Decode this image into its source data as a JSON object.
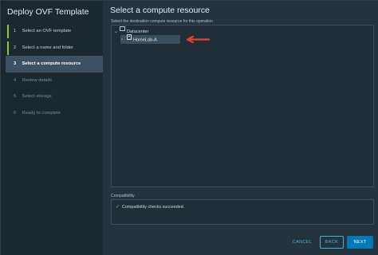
{
  "wizard": {
    "title": "Deploy OVF Template",
    "steps": [
      {
        "num": "1",
        "label": "Select an OVF template"
      },
      {
        "num": "2",
        "label": "Select a name and folder"
      },
      {
        "num": "3",
        "label": "Select a compute resource"
      },
      {
        "num": "4",
        "label": "Review details"
      },
      {
        "num": "5",
        "label": "Select storage"
      },
      {
        "num": "6",
        "label": "Ready to complete"
      }
    ]
  },
  "main": {
    "title": "Select a compute resource",
    "subtitle": "Select the destination compute resource for this operation",
    "tree": {
      "datacenter_label": "Datacenter",
      "host_label": "HomeLab-A",
      "annotation_arrow_color": "#e8412c"
    },
    "compatibility": {
      "label": "Compatibility",
      "message": "Compatibility checks succeeded."
    }
  },
  "footer": {
    "cancel_label": "CANCEL",
    "back_label": "BACK",
    "next_label": "NEXT"
  },
  "colors": {
    "accent": "#0079b8",
    "link": "#49afd9",
    "success": "#8cc63f"
  }
}
